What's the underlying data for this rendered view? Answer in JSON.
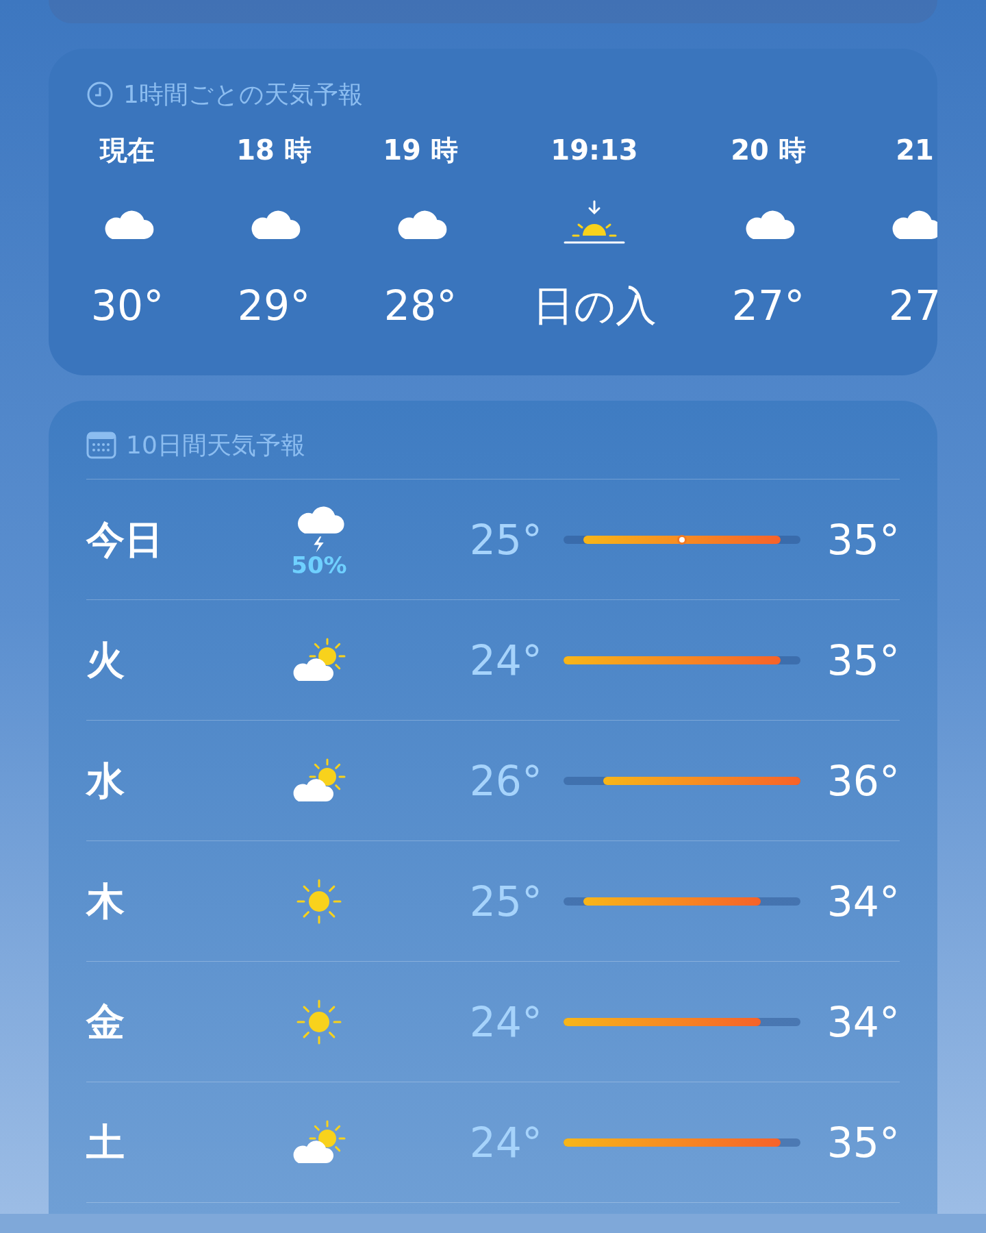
{
  "hourly": {
    "title": "1時間ごとの天気予報",
    "hours": [
      {
        "time": "現在",
        "kind": "cloud",
        "temp": "30°"
      },
      {
        "time": "18 時",
        "kind": "cloud",
        "temp": "29°"
      },
      {
        "time": "19 時",
        "kind": "cloud",
        "temp": "28°"
      },
      {
        "time": "19:13",
        "kind": "sunset",
        "temp": "日の入"
      },
      {
        "time": "20 時",
        "kind": "cloud",
        "temp": "27°"
      },
      {
        "time": "21",
        "kind": "cloud",
        "temp": "27"
      }
    ]
  },
  "daily": {
    "title": "10日間天気予報",
    "days": [
      {
        "day": "今日",
        "kind": "thunder",
        "precip": "50%",
        "low": "25°",
        "high": "35°",
        "current_dot": true
      },
      {
        "day": "火",
        "kind": "partly",
        "low": "24°",
        "high": "35°",
        "current_dot": false
      },
      {
        "day": "水",
        "kind": "partly",
        "low": "26°",
        "high": "36°",
        "current_dot": false
      },
      {
        "day": "木",
        "kind": "sunny",
        "low": "25°",
        "high": "34°",
        "current_dot": false
      },
      {
        "day": "金",
        "kind": "sunny",
        "low": "24°",
        "high": "34°",
        "current_dot": false
      },
      {
        "day": "土",
        "kind": "partly",
        "low": "24°",
        "high": "35°",
        "current_dot": false
      }
    ]
  }
}
